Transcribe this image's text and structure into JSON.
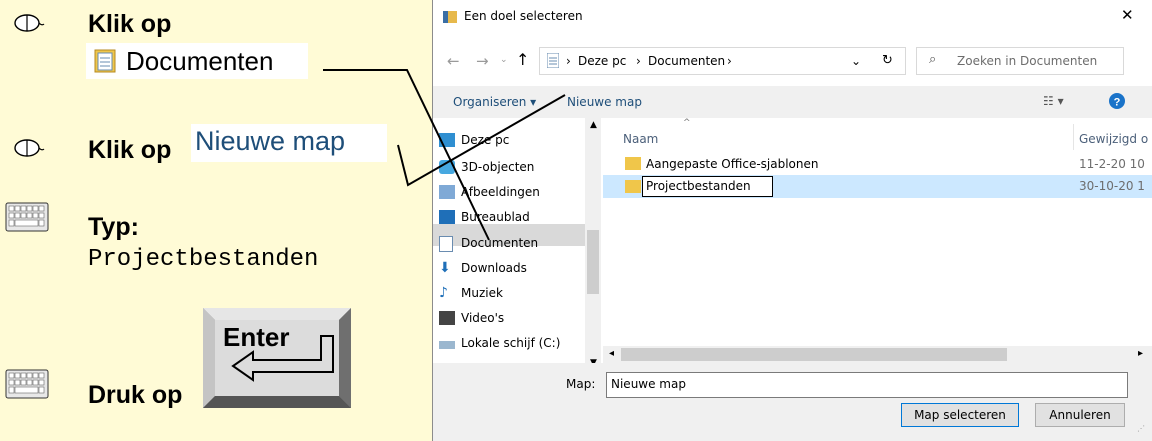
{
  "tutorial": {
    "step1_action": "Klik op",
    "step1_target": "Documenten",
    "step2_action": "Klik op",
    "step2_target": "Nieuwe map",
    "step3_action": "Typ:",
    "step3_value": "Projectbestanden",
    "step4_action": "Druk op",
    "step4_key": "Enter"
  },
  "dialog": {
    "title": "Een doel selecteren",
    "close": "✕",
    "breadcrumb": [
      "Deze pc",
      "Documenten"
    ],
    "search_placeholder": "Zoeken in Documenten",
    "toolbar": {
      "organize": "Organiseren ▾",
      "new_folder": "Nieuwe map"
    },
    "nav_items": [
      "Deze pc",
      "3D-objecten",
      "Afbeeldingen",
      "Bureaublad",
      "Documenten",
      "Downloads",
      "Muziek",
      "Video's",
      "Lokale schijf (C:)"
    ],
    "columns": {
      "name": "Naam",
      "modified": "Gewijzigd o"
    },
    "files": [
      {
        "name": "Aangepaste Office-sjablonen",
        "date": "11-2-20 10"
      },
      {
        "name": "Projectbestanden",
        "date": "30-10-20 1"
      }
    ],
    "folder_label": "Map:",
    "folder_value": "Nieuwe map",
    "select_button": "Map selecteren",
    "cancel_button": "Annuleren"
  }
}
